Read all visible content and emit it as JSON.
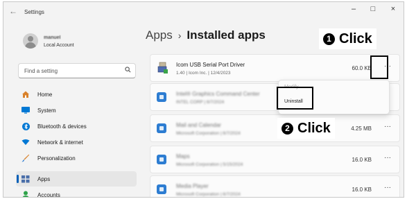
{
  "window": {
    "title": "Settings",
    "back_icon": "back-arrow-icon",
    "controls": [
      "–",
      "□",
      "×"
    ]
  },
  "profile": {
    "name": "manuel",
    "subtitle": "Local Account"
  },
  "search": {
    "placeholder": "Find a setting",
    "icon": "search-icon"
  },
  "sidebar": {
    "items": [
      {
        "label": "Home",
        "icon": "home-icon",
        "color": "#d9822b"
      },
      {
        "label": "System",
        "icon": "monitor-icon",
        "color": "#0078d4"
      },
      {
        "label": "Bluetooth & devices",
        "icon": "bluetooth-icon",
        "color": "#0078d4"
      },
      {
        "label": "Network & internet",
        "icon": "wifi-icon",
        "color": "#0078d4"
      },
      {
        "label": "Personalization",
        "icon": "brush-icon",
        "color": "#d9822b"
      },
      {
        "label": "Apps",
        "icon": "apps-icon",
        "color": "#4a6ea9",
        "active": true
      },
      {
        "label": "Accounts",
        "icon": "accounts-icon",
        "color": "#2fa34a"
      }
    ]
  },
  "header": {
    "root": "Apps",
    "separator": "›",
    "current": "Installed apps"
  },
  "apps": [
    {
      "name": "Icom USB Serial Port Driver",
      "meta": "1.40  |  Icom Inc.  |  12/4/2023",
      "size": "60.0 KB",
      "more": "···"
    },
    {
      "name": "Intel® Graphics Command Center",
      "meta": "INTEL CORP  |  6/7/2024",
      "size": "",
      "more": "···"
    },
    {
      "name": "Mail and Calendar",
      "meta": "Microsoft Corporation  |  6/7/2024",
      "size": "4.25 MB",
      "more": "···"
    },
    {
      "name": "Maps",
      "meta": "Microsoft Corporation  |  5/15/2024",
      "size": "16.0 KB",
      "more": "···"
    },
    {
      "name": "Media Player",
      "meta": "Microsoft Corporation  |  6/7/2024",
      "size": "16.0 KB",
      "more": "···"
    }
  ],
  "context_menu": {
    "items": [
      "Modify",
      "Uninstall"
    ]
  },
  "annotations": {
    "step1_num": "1",
    "step1_label": "Click",
    "step2_num": "2",
    "step2_label": "Click"
  },
  "colors": {
    "accent": "#005fb8",
    "app_icon": "#2d7dd2"
  }
}
